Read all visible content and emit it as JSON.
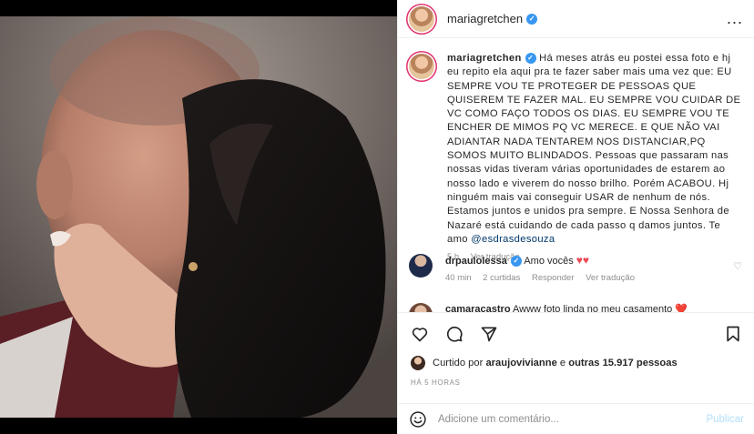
{
  "post": {
    "author": "mariagretchen",
    "caption_user": "mariagretchen",
    "caption_text": "Há meses atrás eu postei essa foto e hj eu repito ela aqui pra te fazer saber mais uma vez que: EU SEMPRE VOU TE PROTEGER DE PESSOAS QUE QUISEREM TE FAZER MAL. EU SEMPRE VOU CUIDAR DE VC COMO FAÇO TODOS OS DIAS. EU SEMPRE VOU TE ENCHER DE MIMOS PQ VC MERECE. E QUE NÃO VAI ADIANTAR NADA TENTAREM NOS DISTANCIAR,PQ SOMOS MUITO BLINDADOS. Pessoas que passaram nas nossas vidas tiveram várias oportunidades de estarem ao nosso lado e viverem do nosso brilho. Porém ACABOU. Hj ninguém mais vai conseguir USAR de nenhum de nós. Estamos juntos e unidos pra sempre. E Nossa Senhora de Nazaré está cuidando de cada passo q damos juntos. Te amo",
    "caption_mention": "@esdrasdesouza",
    "caption_time": "5 h",
    "see_translation": "Ver tradução",
    "more_icon": "..."
  },
  "comments": [
    {
      "user": "drpaulolessa",
      "text": "Amo vocês",
      "hearts": "♥♥",
      "time": "40 min",
      "likes": "2 curtidas",
      "reply": "Responder",
      "translate": "Ver tradução",
      "heart_icon": "♡"
    },
    {
      "user": "camaracastro",
      "text": "Awww foto linda no meu casamento ❤️"
    }
  ],
  "likes": {
    "prefix": "Curtido por",
    "user": "araujovivianne",
    "joiner": "e",
    "others": "outras 15.917 pessoas"
  },
  "time_ago": "HÁ 5 HORAS",
  "add_comment": {
    "placeholder": "Adicione um comentário...",
    "post_label": "Publicar"
  },
  "colors": {
    "verified": "#3897f0",
    "link": "#00376b",
    "heart": "#ed4956",
    "publish_disabled": "#b2dffc"
  }
}
